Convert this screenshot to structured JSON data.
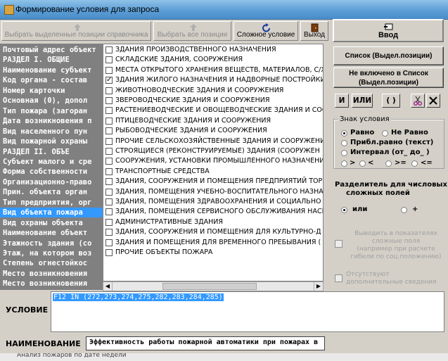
{
  "window": {
    "title": "Формирование условия для запроса"
  },
  "toolbar": {
    "select_selected": "Выбрать выделенные позиции справочника",
    "select_all": "Выбрать все позиции",
    "complex_condition": "Сложное условие",
    "exit": "Выход",
    "input": "Ввод"
  },
  "left_list": [
    "Почтовый адрес объект",
    "    РАЗДЕЛ I. ОБЩИЕ",
    "Наименование субъект",
    "Код органа - состав",
    "Номер карточки",
    "Основная (0), допол",
    "Тип пожара (загоран",
    "Дата возникновения п",
    "Вид населенного пун",
    "Вид пожарной охраны",
    "    РАЗДЕЛ II. ОБЪЕ",
    "Субъект малого и сре",
    "Форма собственности",
    "Организационно-право",
    "Прин. объекта орган",
    "Тип предприятия, орг",
    "Вид объекта пожара",
    "Вид охраны объекта",
    "Наименование объект",
    "Этажность здания (со",
    "Этаж, на котором воз",
    "Степень огнестойкос",
    "Место возникновения",
    "Место возникновения"
  ],
  "left_selected_index": 16,
  "checklist": [
    {
      "label": "ЗДАНИЯ ПРОИЗВОДСТВЕННОГО НАЗНАЧЕНИЯ",
      "checked": false
    },
    {
      "label": "СКЛАДСКИЕ ЗДАНИЯ, СООРУЖЕНИЯ",
      "checked": false
    },
    {
      "label": "МЕСТА ОТКРЫТОГО ХРАНЕНИЯ ВЕЩЕСТВ, МАТЕРИАЛОВ, С/Х",
      "checked": false
    },
    {
      "label": "ЗДАНИЯ ЖИЛОГО НАЗНАЧЕНИЯ И НАДВОРНЫЕ ПОСТРОЙКИ",
      "checked": true
    },
    {
      "label": "ЖИВОТНОВОДЧЕСКИЕ ЗДАНИЯ И СООРУЖЕНИЯ",
      "checked": false
    },
    {
      "label": "ЗВЕРОВОДЧЕСКИЕ ЗДАНИЯ И СООРУЖЕНИЯ",
      "checked": false
    },
    {
      "label": "РАСТЕНИЕВОДЧЕСКИЕ И ОВОЩЕВОДЧЕСКИЕ ЗДАНИЯ И СОО",
      "checked": false
    },
    {
      "label": "ПТИЦЕВОДЧЕСКИЕ ЗДАНИЯ И СООРУЖЕНИЯ",
      "checked": false
    },
    {
      "label": "РЫБОВОДЧЕСКИЕ ЗДАНИЯ И СООРУЖЕНИЯ",
      "checked": false
    },
    {
      "label": "ПРОЧИЕ СЕЛЬСКОХОЗЯЙСТВЕННЫЕ ЗДАНИЯ И СООРУЖЕНИЯ",
      "checked": false
    },
    {
      "label": "СТРОЯЩИЕСЯ (РЕКОНСТРУИРУЕМЫЕ) ЗДАНИЯ (СООРУЖЕН",
      "checked": false
    },
    {
      "label": "СООРУЖЕНИЯ, УСТАНОВКИ ПРОМЫШЛЕННОГО НАЗНАЧЕНИ",
      "checked": false
    },
    {
      "label": "ТРАНСПОРТНЫЕ СРЕДСТВА",
      "checked": false
    },
    {
      "label": "ЗДАНИЯ, СООРУЖЕНИЯ И ПОМЕЩЕНИЯ ПРЕДПРИЯТИЙ ТОР",
      "checked": false
    },
    {
      "label": "ЗДАНИЯ, ПОМЕЩЕНИЯ УЧЕБНО-ВОСПИТАТЕЛЬНОГО НАЗНАЧ",
      "checked": false
    },
    {
      "label": "ЗДАНИЯ, ПОМЕЩЕНИЯ ЗДРАВООХРАНЕНИЯ И СОЦИАЛЬНО",
      "checked": false
    },
    {
      "label": "ЗДАНИЯ, ПОМЕЩЕНИЯ СЕРВИСНОГО ОБСЛУЖИВАНИЯ НАСЕ",
      "checked": false
    },
    {
      "label": "АДМИНИСТРАТИВНЫЕ ЗДАНИЯ",
      "checked": false
    },
    {
      "label": "ЗДАНИЯ, СООРУЖЕНИЯ И ПОМЕЩЕНИЯ ДЛЯ КУЛЬТУРНО-Д",
      "checked": false
    },
    {
      "label": "ЗДАНИЯ И ПОМЕЩЕНИЯ ДЛЯ ВРЕМЕННОГО ПРЕБЫВАНИЯ (",
      "checked": false
    },
    {
      "label": "ПРОЧИЕ ОБЪЕКТЫ ПОЖАРА",
      "checked": false
    }
  ],
  "right": {
    "list_selected": "Список  (Выдел.позиции)",
    "not_in_list_1": "Не включено в Список",
    "not_in_list_2": "(Выдел.позиции)",
    "op_and": "И",
    "op_or": "ИЛИ",
    "op_parens": "( )",
    "sign_group": "Знак условия",
    "signs": {
      "eq": "Равно",
      "ne": "Не Равно",
      "approx": "Прибл.равно (текст)",
      "interval": "Интервал (от_ до_ )",
      "gt": ">",
      "lt": "<",
      "ge": ">=",
      "le": "<="
    },
    "sep_title_1": "Разделитель для числовых",
    "sep_title_2": "сложных полей",
    "sep_or": "или",
    "sep_plus": "+",
    "dim1_lines": [
      "Выводить в показателях",
      "сложные поля",
      "(например при расчете",
      "гибели по соц.положению)"
    ],
    "dim2_lines": [
      "Отсутствуют",
      "дополнительные сведения"
    ]
  },
  "condition": {
    "label": "УСЛОВИЕ",
    "text": "F12 IN (272,273,274,275,282,283,284,285)"
  },
  "name": {
    "label": "НАИМЕНОВАНИЕ",
    "value": "Эффективность работы пожарной автоматики при пожарах в"
  },
  "strip": "Анализ пожаров по дате недели"
}
